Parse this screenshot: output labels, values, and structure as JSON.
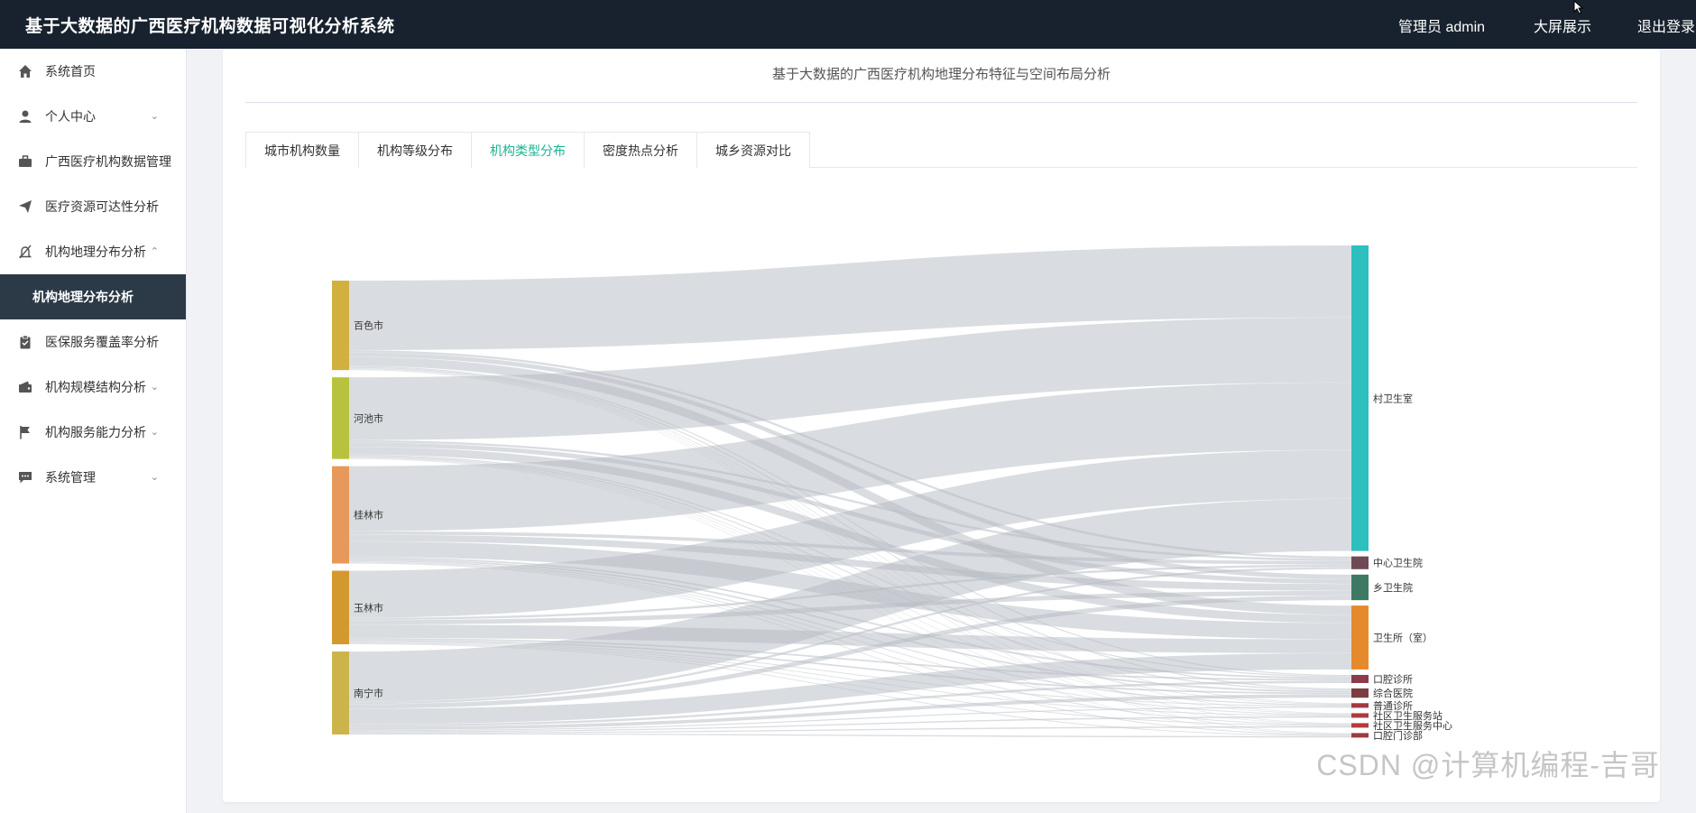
{
  "header": {
    "title": "基于大数据的广西医疗机构数据可视化分析系统",
    "user": "管理员 admin",
    "bigscreen": "大屏展示",
    "logout": "退出登录"
  },
  "sidebar": {
    "items": [
      {
        "label": "系统首页",
        "icon": "home-icon",
        "arrow": ""
      },
      {
        "label": "个人中心",
        "icon": "user-icon",
        "arrow": "⌄"
      },
      {
        "label": "广西医疗机构数据管理",
        "icon": "briefcase-icon",
        "arrow": ""
      },
      {
        "label": "医疗资源可达性分析",
        "icon": "send-icon",
        "arrow": ""
      },
      {
        "label": "机构地理分布分析",
        "icon": "bell-off-icon",
        "arrow": "⌃"
      },
      {
        "label": "机构地理分布分析",
        "icon": "",
        "arrow": ""
      },
      {
        "label": "医保服务覆盖率分析",
        "icon": "clipboard-icon",
        "arrow": ""
      },
      {
        "label": "机构规模结构分析",
        "icon": "wallet-icon",
        "arrow": "⌄"
      },
      {
        "label": "机构服务能力分析",
        "icon": "flag-icon",
        "arrow": "⌄"
      },
      {
        "label": "系统管理",
        "icon": "message-icon",
        "arrow": "⌄"
      }
    ]
  },
  "main": {
    "page_title": "基于大数据的广西医疗机构地理分布特征与空间布局分析",
    "tabs": [
      {
        "label": "城市机构数量"
      },
      {
        "label": "机构等级分布"
      },
      {
        "label": "机构类型分布"
      },
      {
        "label": "密度热点分析"
      },
      {
        "label": "城乡资源对比"
      }
    ],
    "active_tab": 2
  },
  "chart_data": {
    "type": "sankey",
    "sources": [
      {
        "name": "百色市",
        "color": "#d1b040"
      },
      {
        "name": "河池市",
        "color": "#b8c33d"
      },
      {
        "name": "桂林市",
        "color": "#e6995a"
      },
      {
        "name": "玉林市",
        "color": "#d4992e"
      },
      {
        "name": "南宁市",
        "color": "#cdb44a"
      }
    ],
    "targets": [
      {
        "name": "村卫生室",
        "color": "#2ebfbf"
      },
      {
        "name": "中心卫生院",
        "color": "#6e4a55"
      },
      {
        "name": "乡卫生院",
        "color": "#3e7a63"
      },
      {
        "name": "卫生所（室）",
        "color": "#e58a2d"
      },
      {
        "name": "口腔诊所",
        "color": "#8c3b4a"
      },
      {
        "name": "综合医院",
        "color": "#7c3c42"
      },
      {
        "name": "普通诊所",
        "color": "#a33842"
      },
      {
        "name": "社区卫生服务站",
        "color": "#b03a3a"
      },
      {
        "name": "社区卫生服务中心",
        "color": "#b53a3a"
      },
      {
        "name": "口腔门诊部",
        "color": "#9e3a40"
      }
    ],
    "links": [
      {
        "source": "百色市",
        "target": "村卫生室",
        "value": 62
      },
      {
        "source": "百色市",
        "target": "中心卫生院",
        "value": 2
      },
      {
        "source": "百色市",
        "target": "乡卫生院",
        "value": 4
      },
      {
        "source": "百色市",
        "target": "卫生所（室）",
        "value": 8
      },
      {
        "source": "百色市",
        "target": "口腔诊所",
        "value": 1
      },
      {
        "source": "百色市",
        "target": "综合医院",
        "value": 1
      },
      {
        "source": "百色市",
        "target": "普通诊所",
        "value": 0.6
      },
      {
        "source": "百色市",
        "target": "社区卫生服务站",
        "value": 0.4
      },
      {
        "source": "百色市",
        "target": "社区卫生服务中心",
        "value": 0.4
      },
      {
        "source": "百色市",
        "target": "口腔门诊部",
        "value": 0.4
      },
      {
        "source": "河池市",
        "target": "村卫生室",
        "value": 56
      },
      {
        "source": "河池市",
        "target": "中心卫生院",
        "value": 2
      },
      {
        "source": "河池市",
        "target": "乡卫生院",
        "value": 4
      },
      {
        "source": "河池市",
        "target": "卫生所（室）",
        "value": 7
      },
      {
        "source": "河池市",
        "target": "口腔诊所",
        "value": 1
      },
      {
        "source": "河池市",
        "target": "综合医院",
        "value": 1
      },
      {
        "source": "河池市",
        "target": "普通诊所",
        "value": 0.6
      },
      {
        "source": "河池市",
        "target": "社区卫生服务站",
        "value": 0.4
      },
      {
        "source": "河池市",
        "target": "社区卫生服务中心",
        "value": 0.4
      },
      {
        "source": "河池市",
        "target": "口腔门诊部",
        "value": 0.4
      },
      {
        "source": "桂林市",
        "target": "村卫生室",
        "value": 58
      },
      {
        "source": "桂林市",
        "target": "中心卫生院",
        "value": 3
      },
      {
        "source": "桂林市",
        "target": "乡卫生院",
        "value": 6
      },
      {
        "source": "桂林市",
        "target": "卫生所（室）",
        "value": 14
      },
      {
        "source": "桂林市",
        "target": "口腔诊所",
        "value": 1.5
      },
      {
        "source": "桂林市",
        "target": "综合医院",
        "value": 1.5
      },
      {
        "source": "桂林市",
        "target": "普通诊所",
        "value": 1
      },
      {
        "source": "桂林市",
        "target": "社区卫生服务站",
        "value": 0.6
      },
      {
        "source": "桂林市",
        "target": "社区卫生服务中心",
        "value": 0.6
      },
      {
        "source": "桂林市",
        "target": "口腔门诊部",
        "value": 0.6
      },
      {
        "source": "玉林市",
        "target": "村卫生室",
        "value": 42
      },
      {
        "source": "玉林市",
        "target": "中心卫生院",
        "value": 2
      },
      {
        "source": "玉林市",
        "target": "乡卫生院",
        "value": 4
      },
      {
        "source": "玉林市",
        "target": "卫生所（室）",
        "value": 12
      },
      {
        "source": "玉林市",
        "target": "口腔诊所",
        "value": 1.5
      },
      {
        "source": "玉林市",
        "target": "综合医院",
        "value": 1.5
      },
      {
        "source": "玉林市",
        "target": "普通诊所",
        "value": 0.8
      },
      {
        "source": "玉林市",
        "target": "社区卫生服务站",
        "value": 0.6
      },
      {
        "source": "玉林市",
        "target": "社区卫生服务中心",
        "value": 0.6
      },
      {
        "source": "玉林市",
        "target": "口腔门诊部",
        "value": 0.6
      },
      {
        "source": "南宁市",
        "target": "村卫生室",
        "value": 45
      },
      {
        "source": "南宁市",
        "target": "中心卫生院",
        "value": 2
      },
      {
        "source": "南宁市",
        "target": "乡卫生院",
        "value": 4
      },
      {
        "source": "南宁市",
        "target": "卫生所（室）",
        "value": 14
      },
      {
        "source": "南宁市",
        "target": "口腔诊所",
        "value": 2
      },
      {
        "source": "南宁市",
        "target": "综合医院",
        "value": 3
      },
      {
        "source": "南宁市",
        "target": "普通诊所",
        "value": 1
      },
      {
        "source": "南宁市",
        "target": "社区卫生服务站",
        "value": 1
      },
      {
        "source": "南宁市",
        "target": "社区卫生服务中心",
        "value": 1
      },
      {
        "source": "南宁市",
        "target": "口腔门诊部",
        "value": 1
      }
    ]
  },
  "watermark": "CSDN @计算机编程-吉哥"
}
